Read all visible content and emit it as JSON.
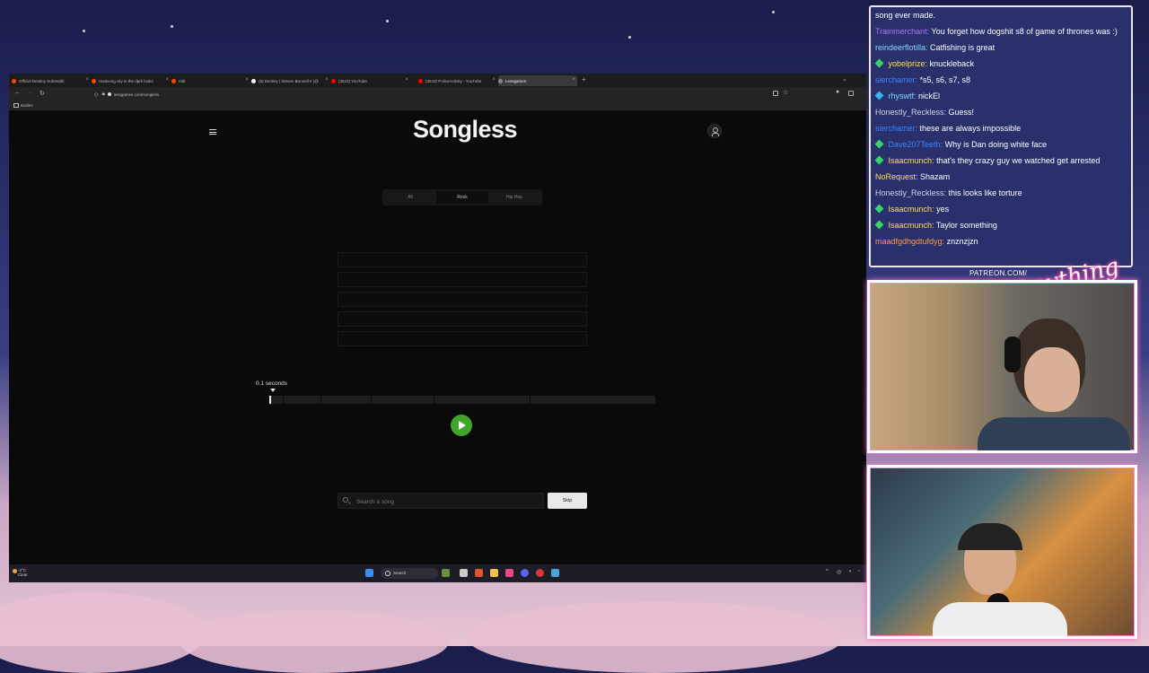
{
  "browser": {
    "tabs": [
      {
        "title": "Official Destiny Subreddit",
        "color": "#ff4500"
      },
      {
        "title": "Hwasong city in the dprk looks",
        "color": "#ff4500"
      },
      {
        "title": "r/all",
        "color": "#ff4500"
      },
      {
        "title": "(5) Destiny | Steven Bonnell II (@",
        "color": "#ffffff"
      },
      {
        "title": "(3643) YouTube",
        "color": "#ff0000"
      },
      {
        "title": "(3643) PoliceActivity - YouTube",
        "color": "#ff0000"
      },
      {
        "title": "Lessgames",
        "color": "#888888"
      }
    ],
    "active_tab_index": 6,
    "url": "lessgames.com/songless",
    "bookmark_folder": "Dailies"
  },
  "songless": {
    "logo": "Songless",
    "genres": [
      "All",
      "Rock",
      "Hip Hop"
    ],
    "active_genre_index": 1,
    "guess_slots": 5,
    "time_label": "0.1 seconds",
    "timeline_progress": 0,
    "search_placeholder": "Search a song",
    "skip_label": "Skip",
    "play_color": "#3fa62a"
  },
  "taskbar": {
    "weather_temp": "-2°C",
    "weather_desc": "Clear",
    "search_label": "Search"
  },
  "chat": {
    "messages": [
      {
        "user": "",
        "user_color": "#ffffff",
        "badge": "",
        "text": "song ever made."
      },
      {
        "user": "Trainmerchant:",
        "user_color": "#b070ff",
        "badge": "",
        "text": "You forget how dogshit s8 of game of thrones was :)"
      },
      {
        "user": "reindeerflotilla:",
        "user_color": "#7fd8ff",
        "badge": "",
        "text": "Catfishing is great"
      },
      {
        "user": "yobelprize:",
        "user_color": "#ffe14a",
        "badge": "green",
        "text": "knuckleback"
      },
      {
        "user": "sierchamer:",
        "user_color": "#3b86ff",
        "badge": "",
        "text": "*s5, s6, s7, s8"
      },
      {
        "user": "rhyswtf:",
        "user_color": "#7fd8ff",
        "badge": "blue",
        "text": "nickEl"
      },
      {
        "user": "Honestly_Reckless:",
        "user_color": "#cfd2e8",
        "badge": "",
        "text": "Guess!"
      },
      {
        "user": "sierchamer:",
        "user_color": "#3b86ff",
        "badge": "",
        "text": "these are always impossible"
      },
      {
        "user": "Dave207Teeth:",
        "user_color": "#3b86ff",
        "badge": "green",
        "text": "Why is Dan doing white face"
      },
      {
        "user": "Isaacmunch:",
        "user_color": "#ffe14a",
        "badge": "green",
        "text": "that's they crazy guy we watched get arrested"
      },
      {
        "user": "NoRequest:",
        "user_color": "#ffe14a",
        "badge": "",
        "text": "Shazam"
      },
      {
        "user": "Honestly_Reckless:",
        "user_color": "#cfd2e8",
        "badge": "",
        "text": "this looks like torture"
      },
      {
        "user": "Isaacmunch:",
        "user_color": "#ffe14a",
        "badge": "green",
        "text": "yes"
      },
      {
        "user": "Isaacmunch:",
        "user_color": "#ffe14a",
        "badge": "green",
        "text": "Taylor something"
      },
      {
        "user": "maadfgdhgdtufdyg:",
        "user_color": "#ff9a3c",
        "badge": "",
        "text": "znznzjzn"
      }
    ]
  },
  "overlay": {
    "patreon": "PATREON.COM/",
    "signature": "Anything Bebe"
  }
}
